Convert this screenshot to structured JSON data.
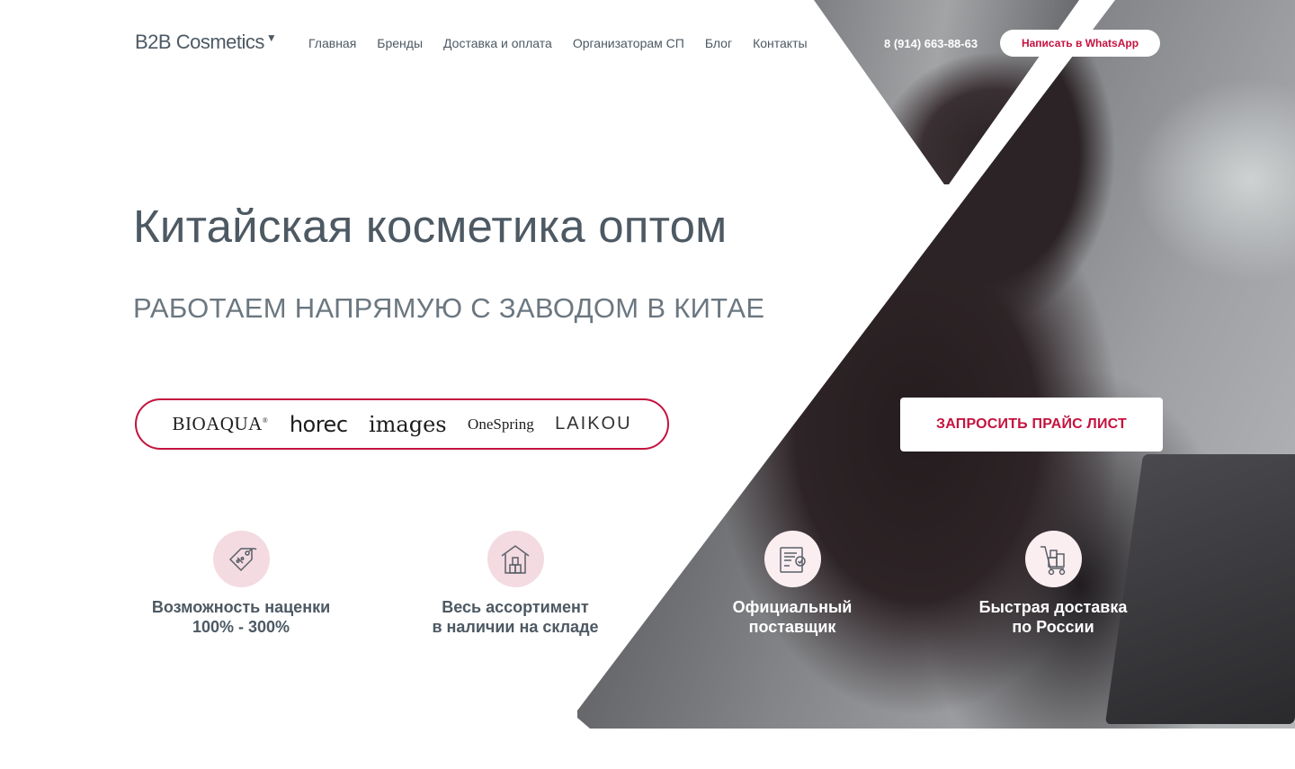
{
  "header": {
    "logo_text": "B2B Cosmetics",
    "nav": [
      "Главная",
      "Бренды",
      "Доставка и оплата",
      "Организаторам СП",
      "Блог",
      "Контакты"
    ],
    "phone": "8 (914) 663-88-63",
    "whatsapp_button": "Написать в WhatsApp"
  },
  "hero": {
    "title": "Китайская косметика оптом",
    "subtitle": "РАБОТАЕМ НАПРЯМУЮ С ЗАВОДОМ В КИТАЕ",
    "cta_button": "ЗАПРОСИТЬ ПРАЙС ЛИСТ"
  },
  "brands": {
    "bioaqua": "BIOAQUA",
    "bioaqua_mark": "®",
    "horec": "horec",
    "images": "images",
    "onespring": "OneSpring",
    "laikou": "LAIKOU"
  },
  "features": [
    {
      "icon": "price-tag-icon",
      "line1": "Возможность наценки",
      "line2": "100% - 300%"
    },
    {
      "icon": "warehouse-icon",
      "line1": "Весь ассортимент",
      "line2": "в наличии на складе"
    },
    {
      "icon": "certificate-icon",
      "line1": "Официальный",
      "line2": "поставщик"
    },
    {
      "icon": "delivery-cart-icon",
      "line1": "Быстрая доставка",
      "line2": "по России"
    }
  ],
  "colors": {
    "accent": "#c4133f",
    "text": "#4d5963",
    "icon_bg": "#f4dbe1"
  }
}
